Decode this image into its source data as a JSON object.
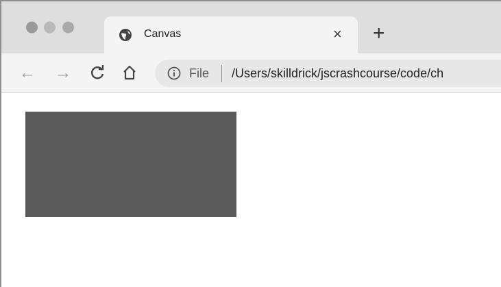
{
  "window": {
    "traffic_lights": [
      "close",
      "minimize",
      "maximize"
    ]
  },
  "tab": {
    "title": "Canvas",
    "icon": "globe-icon",
    "close_label": "×"
  },
  "new_tab_label": "+",
  "toolbar": {
    "back_label": "←",
    "forward_label": "→",
    "reload_label": "C",
    "home_icon": "home-icon"
  },
  "omnibox": {
    "info_icon": "info-icon",
    "scheme_label": "File",
    "url": "/Users/skilldrick/jscrashcourse/code/ch"
  },
  "page": {
    "canvas_fill": "#5a5a5b"
  }
}
